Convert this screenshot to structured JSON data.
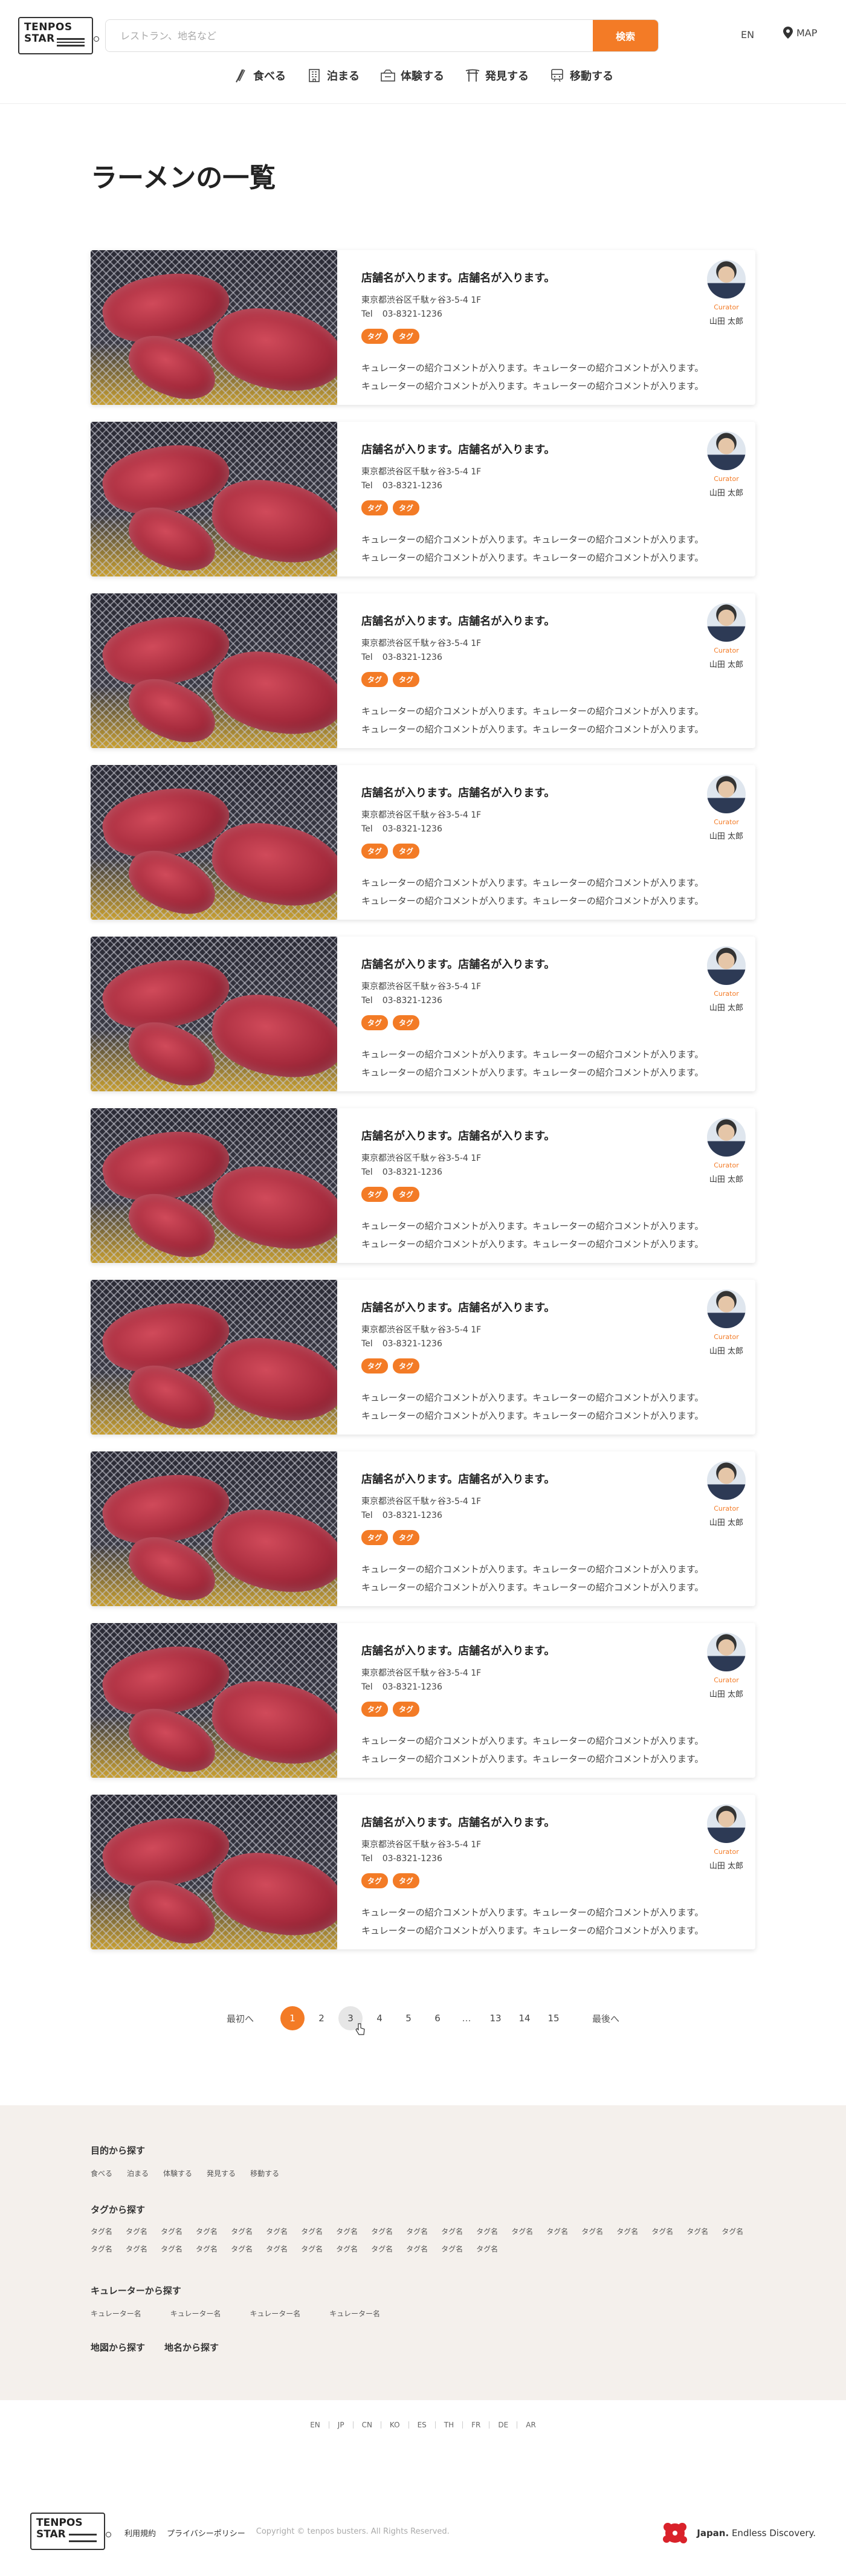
{
  "header": {
    "logo_line1": "TENPOS",
    "logo_line2": "STAR",
    "search_placeholder": "レストラン、地名など",
    "search_button": "検索",
    "lang": "EN",
    "map": "MAP"
  },
  "nav": [
    {
      "label": "食べる",
      "icon": "fork-icon"
    },
    {
      "label": "泊まる",
      "icon": "building-icon"
    },
    {
      "label": "体験する",
      "icon": "experience-icon"
    },
    {
      "label": "発見する",
      "icon": "torii-icon"
    },
    {
      "label": "移動する",
      "icon": "transport-icon"
    }
  ],
  "page_title": "ラーメンの一覧",
  "cards": [
    {
      "name": "店舗名が入ります。店舗名が入ります。",
      "address": "東京都渋谷区千駄ヶ谷3-5-4 1F",
      "tel_label": "Tel",
      "tel": "03-8321-1236",
      "tags": [
        "タグ",
        "タグ"
      ],
      "comment_1": "キュレーターの紹介コメントが入ります。キュレーターの紹介コメントが入ります。",
      "comment_2": "キュレーターの紹介コメントが入ります。キュレーターの紹介コメントが入ります。",
      "curator_role": "Curator",
      "curator_name": "山田 太郎"
    },
    {
      "name": "店舗名が入ります。店舗名が入ります。",
      "address": "東京都渋谷区千駄ヶ谷3-5-4 1F",
      "tel_label": "Tel",
      "tel": "03-8321-1236",
      "tags": [
        "タグ",
        "タグ"
      ],
      "comment_1": "キュレーターの紹介コメントが入ります。キュレーターの紹介コメントが入ります。",
      "comment_2": "キュレーターの紹介コメントが入ります。キュレーターの紹介コメントが入ります。",
      "curator_role": "Curator",
      "curator_name": "山田 太郎"
    },
    {
      "name": "店舗名が入ります。店舗名が入ります。",
      "address": "東京都渋谷区千駄ヶ谷3-5-4 1F",
      "tel_label": "Tel",
      "tel": "03-8321-1236",
      "tags": [
        "タグ",
        "タグ"
      ],
      "comment_1": "キュレーターの紹介コメントが入ります。キュレーターの紹介コメントが入ります。",
      "comment_2": "キュレーターの紹介コメントが入ります。キュレーターの紹介コメントが入ります。",
      "curator_role": "Curator",
      "curator_name": "山田 太郎"
    },
    {
      "name": "店舗名が入ります。店舗名が入ります。",
      "address": "東京都渋谷区千駄ヶ谷3-5-4 1F",
      "tel_label": "Tel",
      "tel": "03-8321-1236",
      "tags": [
        "タグ",
        "タグ"
      ],
      "comment_1": "キュレーターの紹介コメントが入ります。キュレーターの紹介コメントが入ります。",
      "comment_2": "キュレーターの紹介コメントが入ります。キュレーターの紹介コメントが入ります。",
      "curator_role": "Curator",
      "curator_name": "山田 太郎"
    },
    {
      "name": "店舗名が入ります。店舗名が入ります。",
      "address": "東京都渋谷区千駄ヶ谷3-5-4 1F",
      "tel_label": "Tel",
      "tel": "03-8321-1236",
      "tags": [
        "タグ",
        "タグ"
      ],
      "comment_1": "キュレーターの紹介コメントが入ります。キュレーターの紹介コメントが入ります。",
      "comment_2": "キュレーターの紹介コメントが入ります。キュレーターの紹介コメントが入ります。",
      "curator_role": "Curator",
      "curator_name": "山田 太郎"
    },
    {
      "name": "店舗名が入ります。店舗名が入ります。",
      "address": "東京都渋谷区千駄ヶ谷3-5-4 1F",
      "tel_label": "Tel",
      "tel": "03-8321-1236",
      "tags": [
        "タグ",
        "タグ"
      ],
      "comment_1": "キュレーターの紹介コメントが入ります。キュレーターの紹介コメントが入ります。",
      "comment_2": "キュレーターの紹介コメントが入ります。キュレーターの紹介コメントが入ります。",
      "curator_role": "Curator",
      "curator_name": "山田 太郎"
    },
    {
      "name": "店舗名が入ります。店舗名が入ります。",
      "address": "東京都渋谷区千駄ヶ谷3-5-4 1F",
      "tel_label": "Tel",
      "tel": "03-8321-1236",
      "tags": [
        "タグ",
        "タグ"
      ],
      "comment_1": "キュレーターの紹介コメントが入ります。キュレーターの紹介コメントが入ります。",
      "comment_2": "キュレーターの紹介コメントが入ります。キュレーターの紹介コメントが入ります。",
      "curator_role": "Curator",
      "curator_name": "山田 太郎"
    },
    {
      "name": "店舗名が入ります。店舗名が入ります。",
      "address": "東京都渋谷区千駄ヶ谷3-5-4 1F",
      "tel_label": "Tel",
      "tel": "03-8321-1236",
      "tags": [
        "タグ",
        "タグ"
      ],
      "comment_1": "キュレーターの紹介コメントが入ります。キュレーターの紹介コメントが入ります。",
      "comment_2": "キュレーターの紹介コメントが入ります。キュレーターの紹介コメントが入ります。",
      "curator_role": "Curator",
      "curator_name": "山田 太郎"
    },
    {
      "name": "店舗名が入ります。店舗名が入ります。",
      "address": "東京都渋谷区千駄ヶ谷3-5-4 1F",
      "tel_label": "Tel",
      "tel": "03-8321-1236",
      "tags": [
        "タグ",
        "タグ"
      ],
      "comment_1": "キュレーターの紹介コメントが入ります。キュレーターの紹介コメントが入ります。",
      "comment_2": "キュレーターの紹介コメントが入ります。キュレーターの紹介コメントが入ります。",
      "curator_role": "Curator",
      "curator_name": "山田 太郎"
    },
    {
      "name": "店舗名が入ります。店舗名が入ります。",
      "address": "東京都渋谷区千駄ヶ谷3-5-4 1F",
      "tel_label": "Tel",
      "tel": "03-8321-1236",
      "tags": [
        "タグ",
        "タグ"
      ],
      "comment_1": "キュレーターの紹介コメントが入ります。キュレーターの紹介コメントが入ります。",
      "comment_2": "キュレーターの紹介コメントが入ります。キュレーターの紹介コメントが入ります。",
      "curator_role": "Curator",
      "curator_name": "山田 太郎"
    }
  ],
  "pagination": {
    "first": "最初へ",
    "last": "最後へ",
    "pages": [
      "1",
      "2",
      "3",
      "4",
      "5",
      "6"
    ],
    "dots": "…",
    "tail_pages": [
      "13",
      "14",
      "15"
    ],
    "current": "1",
    "hovered": "3"
  },
  "footer": {
    "purpose_title": "目的から探す",
    "purpose_links": [
      "食べる",
      "泊まる",
      "体験する",
      "発見する",
      "移動する"
    ],
    "tag_title": "タグから探す",
    "tag_links": [
      "タグ名",
      "タグ名",
      "タグ名",
      "タグ名",
      "タグ名",
      "タグ名",
      "タグ名",
      "タグ名",
      "タグ名",
      "タグ名",
      "タグ名",
      "タグ名",
      "タグ名",
      "タグ名",
      "タグ名",
      "タグ名",
      "タグ名",
      "タグ名",
      "タグ名",
      "タグ名",
      "タグ名",
      "タグ名",
      "タグ名",
      "タグ名",
      "タグ名",
      "タグ名",
      "タグ名",
      "タグ名",
      "タグ名",
      "タグ名",
      "タグ名"
    ],
    "curator_title": "キュレーターから探す",
    "curator_links": [
      "キュレーター名",
      "キュレーター名",
      "キュレーター名",
      "キュレーター名"
    ],
    "map_search": "地図から探す",
    "place_search": "地名から探す"
  },
  "languages": [
    "EN",
    "JP",
    "CN",
    "KO",
    "ES",
    "TH",
    "FR",
    "DE",
    "AR"
  ],
  "bottom": {
    "terms": "利用規約",
    "privacy": "プライバシーポリシー",
    "copyright": "Copyright © tenpos busters. All Rights Reserved.",
    "japan_bold": "Japan.",
    "japan_tagline": " Endless Discovery."
  },
  "colors": {
    "accent": "#f37b26",
    "footer_bg": "#f4f0ec"
  }
}
